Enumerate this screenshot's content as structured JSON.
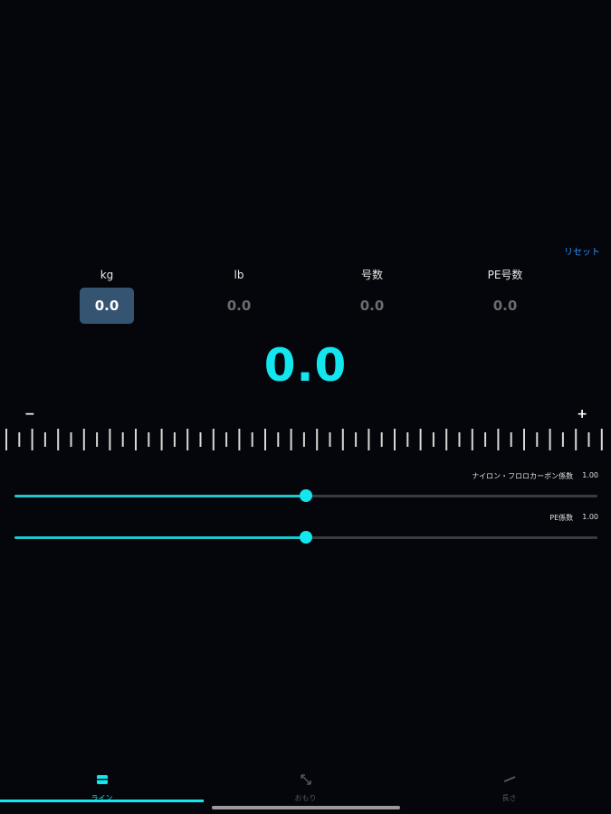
{
  "reset_label": "リセット",
  "units": [
    {
      "label": "kg",
      "value": "0.0",
      "active": true
    },
    {
      "label": "lb",
      "value": "0.0",
      "active": false
    },
    {
      "label": "号数",
      "value": "0.0",
      "active": false
    },
    {
      "label": "PE号数",
      "value": "0.0",
      "active": false
    }
  ],
  "main_value": "0.0",
  "stepper": {
    "minus": "−",
    "plus": "+"
  },
  "sliders": [
    {
      "label": "ナイロン・フロロカーボン係数",
      "value_text": "1.00",
      "level": 0.5
    },
    {
      "label": "PE係数",
      "value_text": "1.00",
      "level": 0.5
    }
  ],
  "tabs": [
    {
      "label": "ライン",
      "icon": "line-spool-icon",
      "active": true
    },
    {
      "label": "おもり",
      "icon": "weight-arrows-icon",
      "active": false
    },
    {
      "label": "長さ",
      "icon": "length-ruler-icon",
      "active": false
    }
  ],
  "colors": {
    "accent": "#12e6ee",
    "background": "#05060b",
    "active_unit_bg": "#355471",
    "link": "#2f8ef4"
  }
}
